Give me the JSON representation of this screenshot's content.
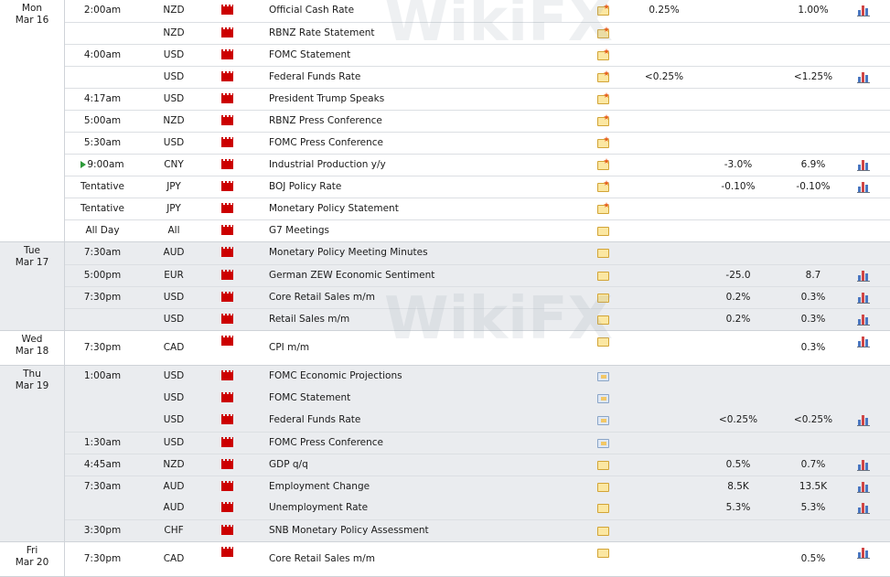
{
  "watermark": "WikiFX",
  "days": [
    {
      "weekday": "Mon",
      "date": "Mar 16",
      "shade": false,
      "events": [
        {
          "time": "2:00am",
          "currency": "NZD",
          "event": "Official Cash Rate",
          "actual": "0.25%",
          "forecast": "",
          "previous": "1.00%",
          "folder": "star",
          "chart": true
        },
        {
          "time": "",
          "currency": "NZD",
          "event": "RBNZ Rate Statement",
          "actual": "",
          "forecast": "",
          "previous": "",
          "folder": "star",
          "chart": false
        },
        {
          "time": "4:00am",
          "currency": "USD",
          "event": "FOMC Statement",
          "actual": "",
          "forecast": "",
          "previous": "",
          "folder": "star",
          "chart": false
        },
        {
          "time": "",
          "currency": "USD",
          "event": "Federal Funds Rate",
          "actual": "<0.25%",
          "forecast": "",
          "previous": "<1.25%",
          "folder": "star",
          "chart": true
        },
        {
          "time": "4:17am",
          "currency": "USD",
          "event": "President Trump Speaks",
          "actual": "",
          "forecast": "",
          "previous": "",
          "folder": "star",
          "chart": false
        },
        {
          "time": "5:00am",
          "currency": "NZD",
          "event": "RBNZ Press Conference",
          "actual": "",
          "forecast": "",
          "previous": "",
          "folder": "star",
          "chart": false
        },
        {
          "time": "5:30am",
          "currency": "USD",
          "event": "FOMC Press Conference",
          "actual": "",
          "forecast": "",
          "previous": "",
          "folder": "star",
          "chart": false
        },
        {
          "time": "9:00am",
          "currency": "CNY",
          "event": "Industrial Production y/y",
          "actual": "",
          "forecast": "-3.0%",
          "previous": "6.9%",
          "folder": "star",
          "chart": true,
          "current": true
        },
        {
          "time": "Tentative",
          "currency": "JPY",
          "event": "BOJ Policy Rate",
          "actual": "",
          "forecast": "-0.10%",
          "previous": "-0.10%",
          "folder": "star",
          "chart": true
        },
        {
          "time": "Tentative",
          "currency": "JPY",
          "event": "Monetary Policy Statement",
          "actual": "",
          "forecast": "",
          "previous": "",
          "folder": "star",
          "chart": false
        },
        {
          "time": "All Day",
          "currency": "All",
          "event": "G7 Meetings",
          "actual": "",
          "forecast": "",
          "previous": "",
          "folder": "plain",
          "chart": false
        }
      ]
    },
    {
      "weekday": "Tue",
      "date": "Mar 17",
      "shade": true,
      "events": [
        {
          "time": "7:30am",
          "currency": "AUD",
          "event": "Monetary Policy Meeting Minutes",
          "actual": "",
          "forecast": "",
          "previous": "",
          "folder": "plain",
          "chart": false
        },
        {
          "time": "5:00pm",
          "currency": "EUR",
          "event": "German ZEW Economic Sentiment",
          "actual": "",
          "forecast": "-25.0",
          "previous": "8.7",
          "folder": "plain",
          "chart": true
        },
        {
          "time": "7:30pm",
          "currency": "USD",
          "event": "Core Retail Sales m/m",
          "actual": "",
          "forecast": "0.2%",
          "previous": "0.3%",
          "folder": "plain",
          "chart": true
        },
        {
          "time": "",
          "currency": "USD",
          "event": "Retail Sales m/m",
          "actual": "",
          "forecast": "0.2%",
          "previous": "0.3%",
          "folder": "plain",
          "chart": true
        }
      ]
    },
    {
      "weekday": "Wed",
      "date": "Mar 18",
      "shade": false,
      "events": [
        {
          "time": "7:30pm",
          "currency": "CAD",
          "event": "CPI m/m",
          "actual": "",
          "forecast": "",
          "previous": "0.3%",
          "folder": "plain",
          "chart": true,
          "tall": true
        }
      ]
    },
    {
      "weekday": "Thu",
      "date": "Mar 19",
      "shade": true,
      "events": [
        {
          "time": "1:00am",
          "currency": "USD",
          "event": "FOMC Economic Projections",
          "actual": "",
          "forecast": "",
          "previous": "",
          "folder": "alt",
          "chart": false
        },
        {
          "time": "",
          "currency": "USD",
          "event": "FOMC Statement",
          "actual": "",
          "forecast": "",
          "previous": "",
          "folder": "alt",
          "chart": false,
          "nob": true
        },
        {
          "time": "",
          "currency": "USD",
          "event": "Federal Funds Rate",
          "actual": "",
          "forecast": "<0.25%",
          "previous": "<0.25%",
          "folder": "alt",
          "chart": true,
          "nob": true
        },
        {
          "time": "1:30am",
          "currency": "USD",
          "event": "FOMC Press Conference",
          "actual": "",
          "forecast": "",
          "previous": "",
          "folder": "alt",
          "chart": false
        },
        {
          "time": "4:45am",
          "currency": "NZD",
          "event": "GDP q/q",
          "actual": "",
          "forecast": "0.5%",
          "previous": "0.7%",
          "folder": "plain",
          "chart": true
        },
        {
          "time": "7:30am",
          "currency": "AUD",
          "event": "Employment Change",
          "actual": "",
          "forecast": "8.5K",
          "previous": "13.5K",
          "folder": "plain",
          "chart": true
        },
        {
          "time": "",
          "currency": "AUD",
          "event": "Unemployment Rate",
          "actual": "",
          "forecast": "5.3%",
          "previous": "5.3%",
          "folder": "plain",
          "chart": true,
          "nob": true
        },
        {
          "time": "3:30pm",
          "currency": "CHF",
          "event": "SNB Monetary Policy Assessment",
          "actual": "",
          "forecast": "",
          "previous": "",
          "folder": "plain",
          "chart": false
        }
      ]
    },
    {
      "weekday": "Fri",
      "date": "Mar 20",
      "shade": false,
      "events": [
        {
          "time": "7:30pm",
          "currency": "CAD",
          "event": "Core Retail Sales m/m",
          "actual": "",
          "forecast": "",
          "previous": "0.5%",
          "folder": "plain",
          "chart": true,
          "tall": true
        }
      ]
    }
  ]
}
